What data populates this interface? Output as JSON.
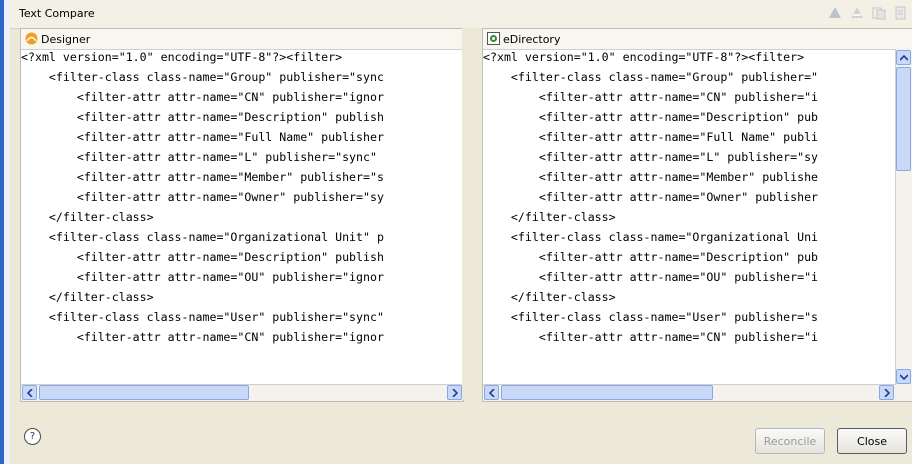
{
  "window": {
    "title": "Text Compare"
  },
  "toolbar_icons": [
    "next-change-icon",
    "previous-change-icon",
    "copy-left-icon",
    "copy-right-icon"
  ],
  "left_pane": {
    "title": "Designer",
    "icon": "designer-icon",
    "lines": [
      "<?xml version=\"1.0\" encoding=\"UTF-8\"?><filter>",
      "    <filter-class class-name=\"Group\" publisher=\"sync",
      "        <filter-attr attr-name=\"CN\" publisher=\"ignor",
      "        <filter-attr attr-name=\"Description\" publish",
      "        <filter-attr attr-name=\"Full Name\" publisher",
      "        <filter-attr attr-name=\"L\" publisher=\"sync\" ",
      "        <filter-attr attr-name=\"Member\" publisher=\"s",
      "        <filter-attr attr-name=\"Owner\" publisher=\"sy",
      "    </filter-class>",
      "    <filter-class class-name=\"Organizational Unit\" p",
      "        <filter-attr attr-name=\"Description\" publish",
      "        <filter-attr attr-name=\"OU\" publisher=\"ignor",
      "    </filter-class>",
      "    <filter-class class-name=\"User\" publisher=\"sync\"",
      "        <filter-attr attr-name=\"CN\" publisher=\"ignor"
    ]
  },
  "right_pane": {
    "title": "eDirectory",
    "icon": "edirectory-icon",
    "lines": [
      "<?xml version=\"1.0\" encoding=\"UTF-8\"?><filter>",
      "    <filter-class class-name=\"Group\" publisher=\"",
      "        <filter-attr attr-name=\"CN\" publisher=\"i",
      "        <filter-attr attr-name=\"Description\" pub",
      "        <filter-attr attr-name=\"Full Name\" publi",
      "        <filter-attr attr-name=\"L\" publisher=\"sy",
      "        <filter-attr attr-name=\"Member\" publishe",
      "        <filter-attr attr-name=\"Owner\" publisher",
      "    </filter-class>",
      "    <filter-class class-name=\"Organizational Uni",
      "        <filter-attr attr-name=\"Description\" pub",
      "        <filter-attr attr-name=\"OU\" publisher=\"i",
      "    </filter-class>",
      "    <filter-class class-name=\"User\" publisher=\"s",
      "        <filter-attr attr-name=\"CN\" publisher=\"i"
    ]
  },
  "footer": {
    "help_label": "?",
    "reconcile_label": "Reconcile",
    "close_label": "Close"
  },
  "colors": {
    "accent": "#2b66c9",
    "scrollbar": "#c9d8f7"
  }
}
